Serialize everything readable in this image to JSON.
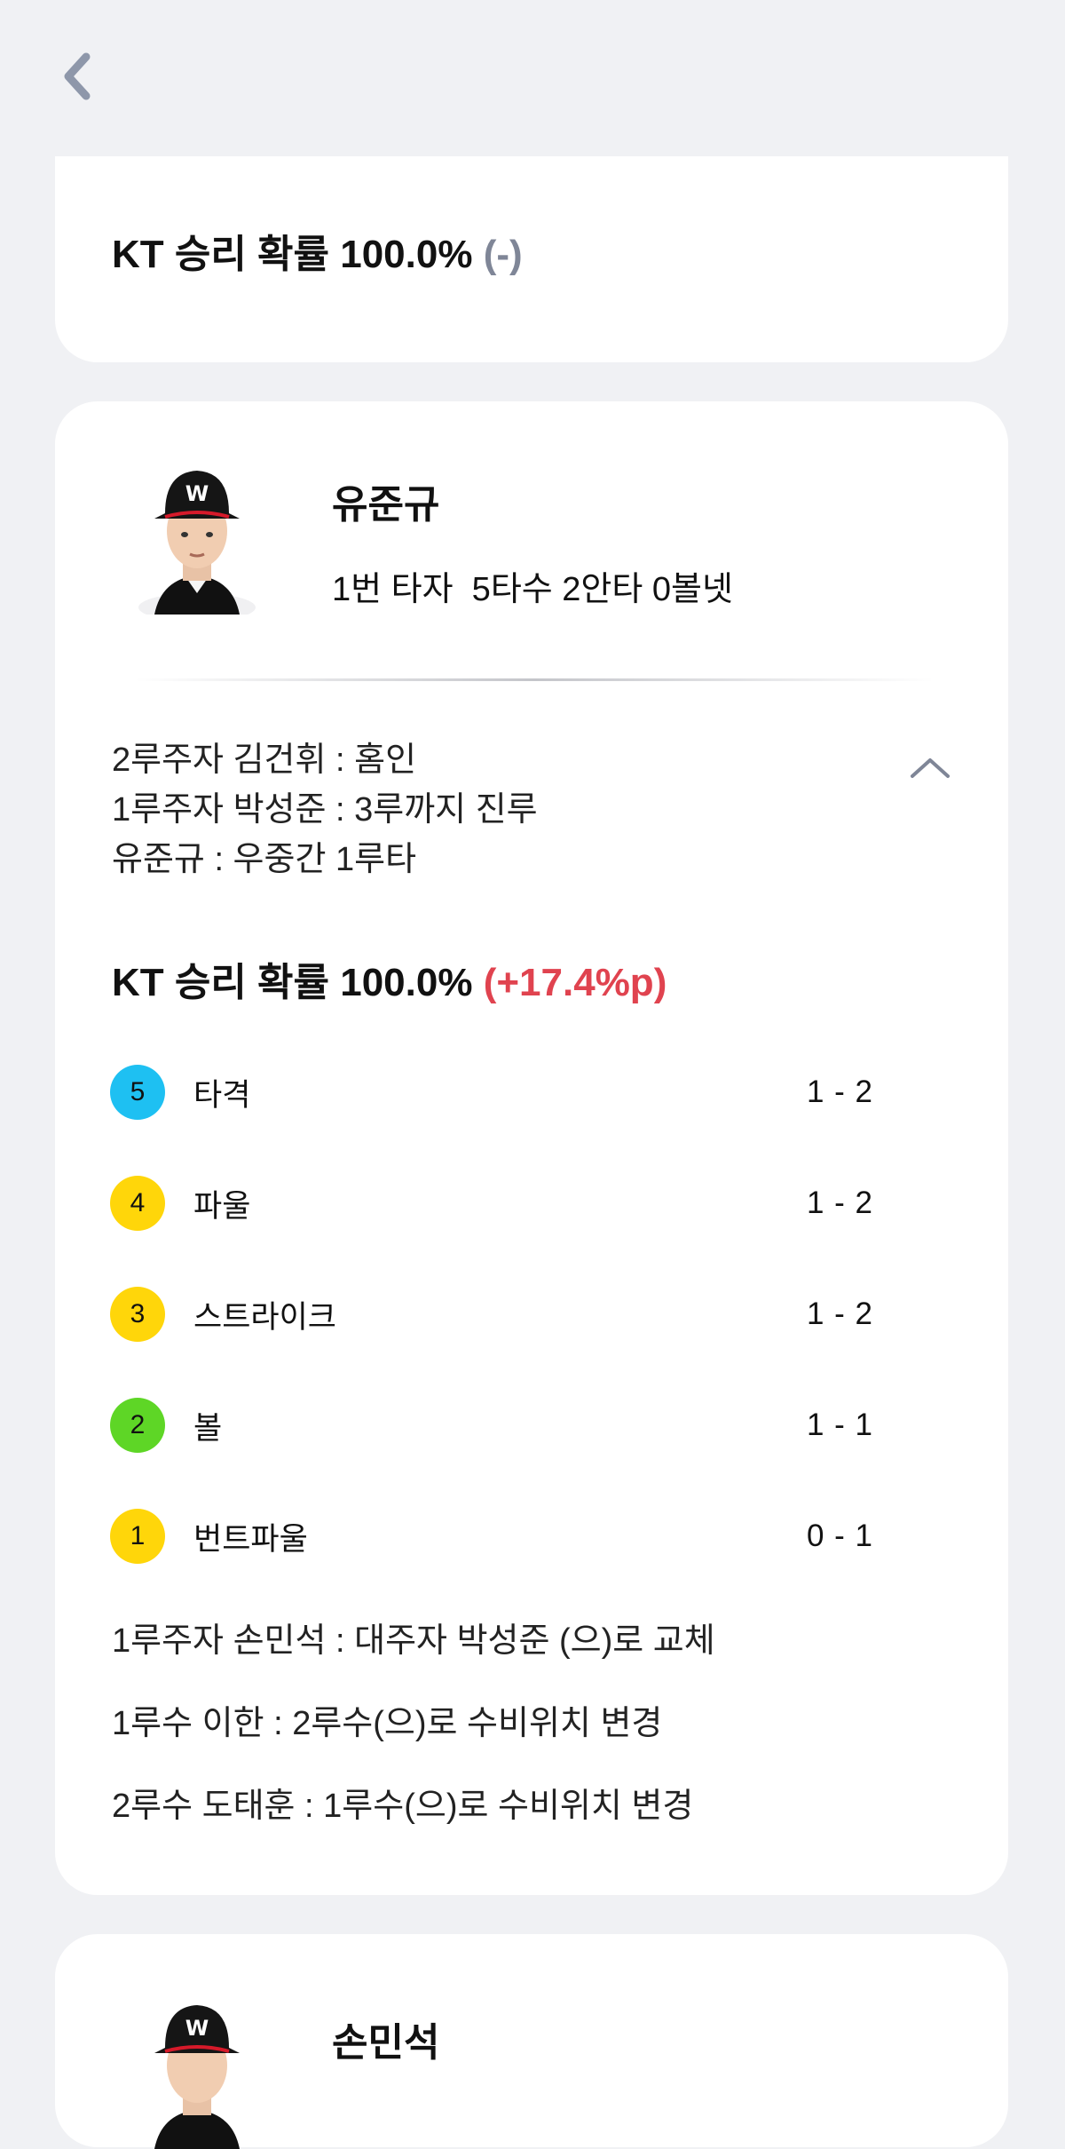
{
  "colors": {
    "background": "#f0f1f4",
    "card": "#ffffff",
    "delta_up": "#e0434f",
    "delta_neutral": "#7f8697",
    "hit": "#1ec0f2",
    "strike": "#ffd60a",
    "ball": "#5ed626"
  },
  "header": {
    "back_icon": "chevron-left-icon"
  },
  "top_card": {
    "win_prob_text": "KT 승리 확률 100.0% ",
    "win_prob_delta": "(-)"
  },
  "at_bat": {
    "player_name": "유준규",
    "player_stats": "1번 타자  5타수 2안타 0볼넷",
    "play_results": [
      "2루주자 김건휘 : 홈인",
      "1루주자 박성준 : 3루까지 진루",
      "유준규 : 우중간 1루타"
    ],
    "collapse_icon": "chevron-up-icon",
    "win_prob_text": "KT 승리 확률 100.0% ",
    "win_prob_delta": "(+17.4%p)",
    "pitches": [
      {
        "num": "5",
        "label": "타격",
        "count": "1 - 2",
        "color": "#1ec0f2"
      },
      {
        "num": "4",
        "label": "파울",
        "count": "1 - 2",
        "color": "#ffd60a"
      },
      {
        "num": "3",
        "label": "스트라이크",
        "count": "1 - 2",
        "color": "#ffd60a"
      },
      {
        "num": "2",
        "label": "볼",
        "count": "1 - 1",
        "color": "#5ed626"
      },
      {
        "num": "1",
        "label": "번트파울",
        "count": "0 - 1",
        "color": "#ffd60a"
      }
    ],
    "substitutions": [
      "1루주자 손민석 : 대주자 박성준 (으)로 교체",
      "1루수 이한 : 2루수(으)로 수비위치 변경",
      "2루수 도태훈 : 1루수(으)로 수비위치 변경"
    ]
  },
  "next_at_bat": {
    "player_name": "손민석"
  }
}
